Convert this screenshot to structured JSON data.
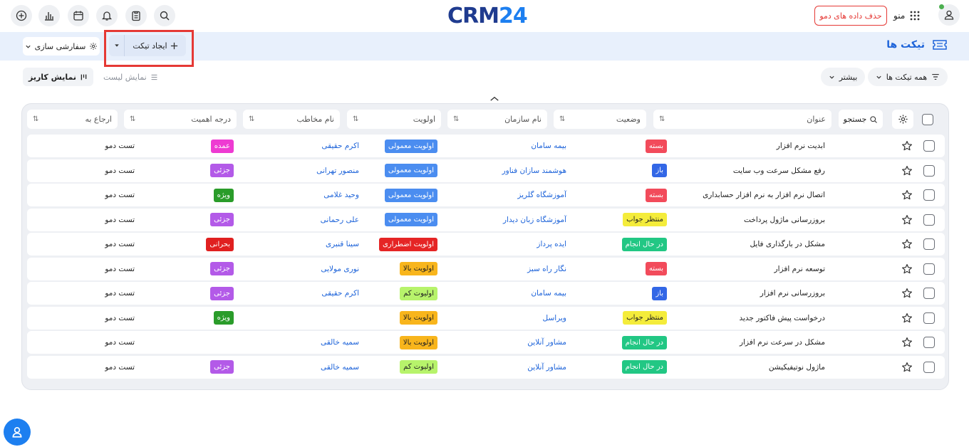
{
  "topbar": {
    "logo_crm": "CRM",
    "logo_num": "24",
    "delete_demo_label": "حذف داده های دمو",
    "menu_label": "منو"
  },
  "header": {
    "page_title": "تیکت ها",
    "create_label": "ایجاد تیکت",
    "customize_label": "سفارشی سازی"
  },
  "filters": {
    "all_tickets_label": "همه تیکت ها",
    "more_label": "بیشتر",
    "list_view_label": "نمایش لیست",
    "kanban_view_label": "نمایش کاریز"
  },
  "table": {
    "search_label": "جستجو",
    "columns": [
      "عنوان",
      "وضعیت",
      "نام سازمان",
      "اولویت",
      "نام مخاطب",
      "درجه اهمیت",
      "ارجاع به"
    ],
    "sort_glyph": "⇅",
    "rows": [
      {
        "title": "ابدیت نرم افزار",
        "status": "بسته",
        "org": "بیمه سامان",
        "priority": "اولویت معمولی",
        "contact": "اکرم حقیقی",
        "importance": "عمده",
        "ref": "تست دمو"
      },
      {
        "title": "رفع مشکل سرعت وب سایت",
        "status": "باز",
        "org": "هوشمند سازان فناور",
        "priority": "اولویت معمولی",
        "contact": "منصور تهرانی",
        "importance": "جزئی",
        "ref": "تست دمو"
      },
      {
        "title": "اتصال نرم افزار به نرم افزار حسابداری",
        "status": "بسته",
        "org": "آموزشگاه گلریز",
        "priority": "اولویت معمولی",
        "contact": "وحید غلامی",
        "importance": "ویژه",
        "ref": "تست دمو"
      },
      {
        "title": "بروزرسانی ماژول پرداخت",
        "status": "منتظر جواب",
        "org": "آموزشگاه زبان دیدار",
        "priority": "اولویت معمولی",
        "contact": "علی رحمانی",
        "importance": "جزئی",
        "ref": "تست دمو"
      },
      {
        "title": "مشکل در بارگذاری فایل",
        "status": "در حال انجام",
        "org": "ایده پرداز",
        "priority": "اولویت اضطراری",
        "contact": "سینا قنبری",
        "importance": "بحرانی",
        "ref": "تست دمو"
      },
      {
        "title": "توسعه نرم افزار",
        "status": "بسته",
        "org": "نگار راه سبز",
        "priority": "اولویت بالا",
        "contact": "نوری مولایی",
        "importance": "جزئی",
        "ref": "تست دمو"
      },
      {
        "title": "بروزرسانی نرم افزار",
        "status": "باز",
        "org": "بیمه سامان",
        "priority": "اولیوت کم",
        "contact": "اکرم حقیقی",
        "importance": "جزئی",
        "ref": "تست دمو"
      },
      {
        "title": "درخواست پیش فاکتور جدید",
        "status": "منتظر جواب",
        "org": "ویراسل",
        "priority": "اولویت بالا",
        "contact": "",
        "importance": "ویژه",
        "ref": "تست دمو"
      },
      {
        "title": "مشکل در سرعت نرم افزار",
        "status": "در حال انجام",
        "org": "مشاور آنلاین",
        "priority": "اولویت بالا",
        "contact": "سمیه خالقی",
        "importance": "",
        "ref": "تست دمو"
      },
      {
        "title": "ماژول نوتیفیکیشن",
        "status": "در حال انجام",
        "org": "مشاور آنلاین",
        "priority": "اولیوت کم",
        "contact": "سمیه خالقی",
        "importance": "جزئی",
        "ref": "تست دمو"
      }
    ]
  },
  "colors": {
    "status": {
      "بسته": [
        "#f24b5b",
        "#ffffff"
      ],
      "باز": [
        "#3367e6",
        "#ffffff"
      ],
      "منتظر جواب": [
        "#f4ec3b",
        "#222222"
      ],
      "در حال انجام": [
        "#22c784",
        "#ffffff"
      ]
    },
    "priority": {
      "اولویت معمولی": [
        "#4b8df0",
        "#ffffff"
      ],
      "اولویت اضطراری": [
        "#e52525",
        "#ffffff"
      ],
      "اولویت بالا": [
        "#f8b51c",
        "#222222"
      ],
      "اولیوت کم": [
        "#b7f36b",
        "#222222"
      ]
    },
    "importance": {
      "عمده": [
        "#ee3bd2",
        "#ffffff"
      ],
      "جزئی": [
        "#b35ae8",
        "#ffffff"
      ],
      "ویژه": [
        "#2a9c2a",
        "#ffffff"
      ],
      "بحرانی": [
        "#e02020",
        "#ffffff"
      ]
    }
  }
}
